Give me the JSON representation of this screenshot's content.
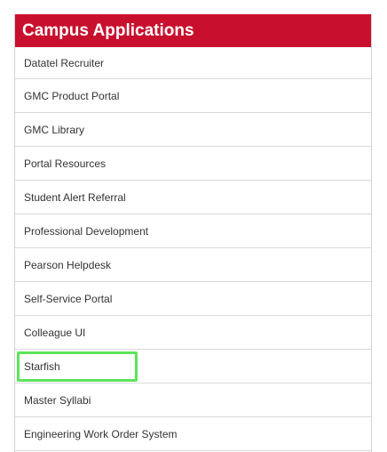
{
  "header": {
    "title": "Campus Applications",
    "color": "#c8102e"
  },
  "apps": [
    {
      "label": "Datatel Recruiter"
    },
    {
      "label": "GMC Product Portal"
    },
    {
      "label": "GMC Library"
    },
    {
      "label": "Portal Resources"
    },
    {
      "label": "Student Alert Referral"
    },
    {
      "label": "Professional Development"
    },
    {
      "label": "Pearson Helpdesk"
    },
    {
      "label": "Self-Service Portal"
    },
    {
      "label": "Colleague UI"
    },
    {
      "label": "Starfish",
      "highlighted": true
    },
    {
      "label": "Master Syllabi"
    },
    {
      "label": "Engineering Work Order System"
    }
  ],
  "highlight_color": "#5ce45c"
}
